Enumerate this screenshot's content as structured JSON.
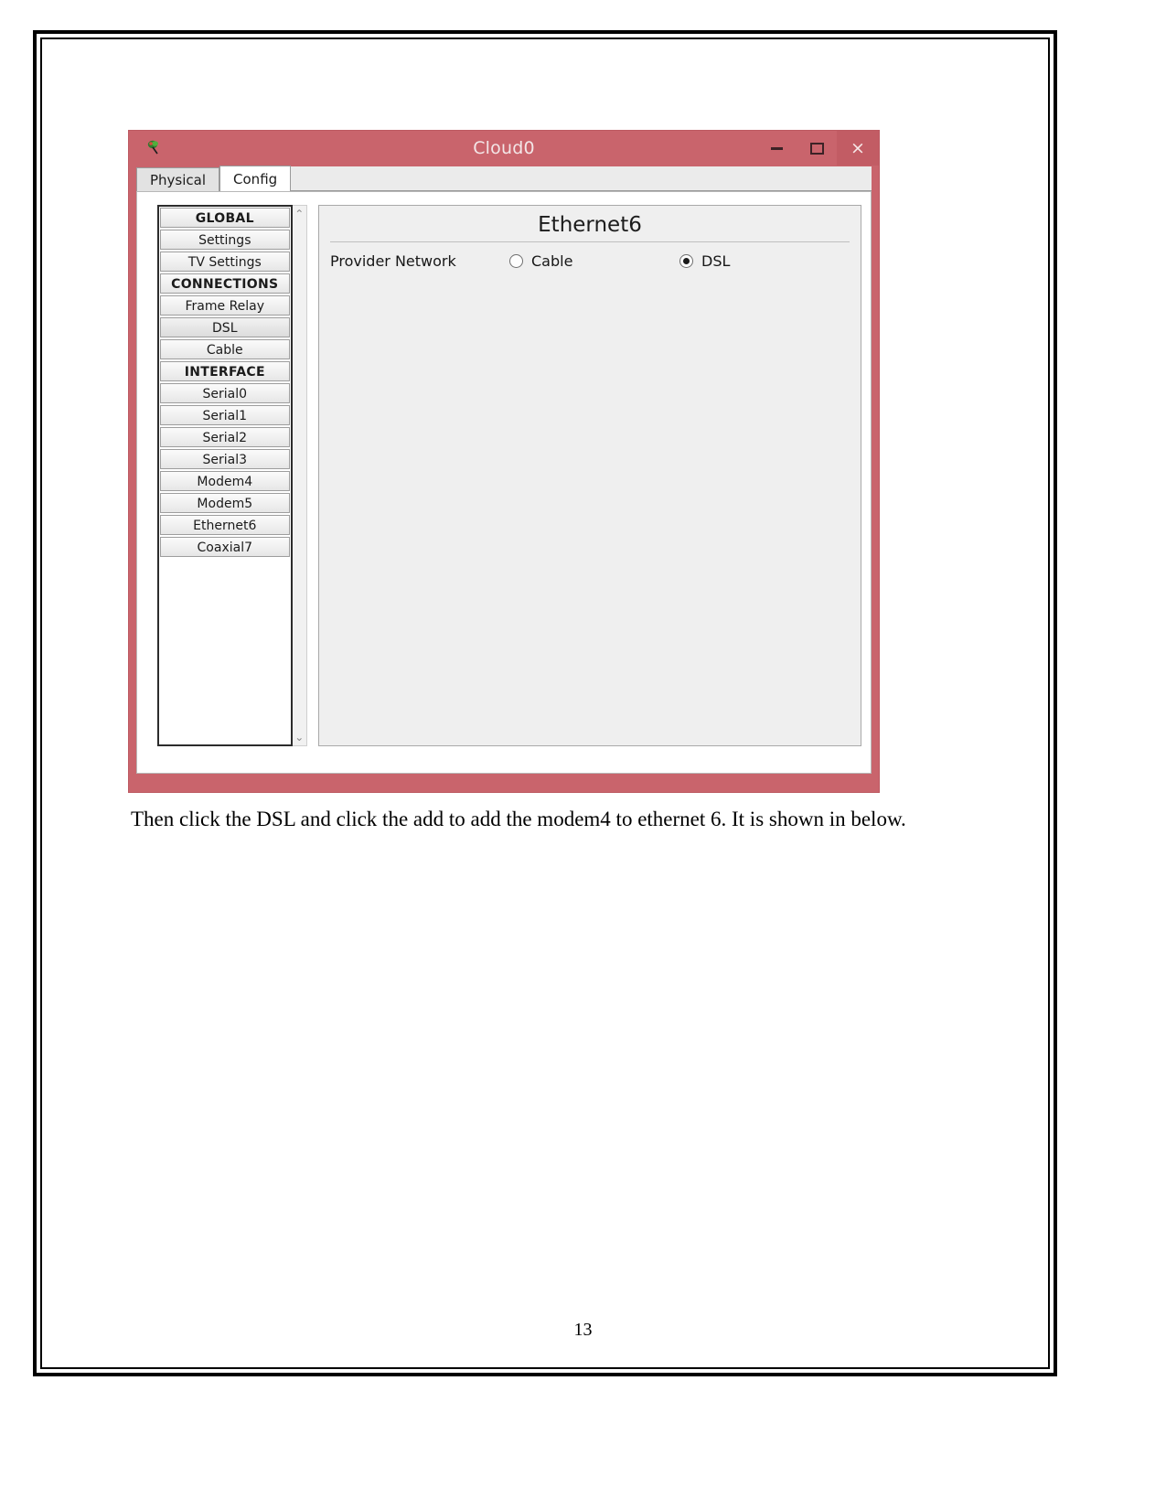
{
  "document": {
    "caption": "Then click the DSL and click the add to add the modem4 to ethernet 6. It is shown in below.",
    "page_number": "13"
  },
  "window": {
    "title": "Cloud0",
    "icon": "packet-tracer-cloud-icon",
    "controls": {
      "minimize": "–",
      "maximize": "□",
      "close": "×"
    },
    "accent_color": "#c9646c",
    "tabs": [
      {
        "label": "Physical",
        "active": false
      },
      {
        "label": "Config",
        "active": true
      }
    ]
  },
  "sidebar": {
    "items": [
      {
        "label": "GLOBAL",
        "type": "group",
        "selected": false
      },
      {
        "label": "Settings",
        "type": "item",
        "selected": false
      },
      {
        "label": "TV Settings",
        "type": "item",
        "selected": false
      },
      {
        "label": "CONNECTIONS",
        "type": "group",
        "selected": false
      },
      {
        "label": "Frame Relay",
        "type": "item",
        "selected": false
      },
      {
        "label": "DSL",
        "type": "item",
        "selected": true
      },
      {
        "label": "Cable",
        "type": "item",
        "selected": false
      },
      {
        "label": "INTERFACE",
        "type": "group",
        "selected": false
      },
      {
        "label": "Serial0",
        "type": "item",
        "selected": false
      },
      {
        "label": "Serial1",
        "type": "item",
        "selected": false
      },
      {
        "label": "Serial2",
        "type": "item",
        "selected": false
      },
      {
        "label": "Serial3",
        "type": "item",
        "selected": false
      },
      {
        "label": "Modem4",
        "type": "item",
        "selected": false
      },
      {
        "label": "Modem5",
        "type": "item",
        "selected": false
      },
      {
        "label": "Ethernet6",
        "type": "item",
        "selected": false
      },
      {
        "label": "Coaxial7",
        "type": "item",
        "selected": false
      }
    ],
    "scrollbar": {
      "up_arrow": "⌃",
      "down_arrow": "⌄"
    }
  },
  "config_panel": {
    "heading": "Ethernet6",
    "provider_network": {
      "label": "Provider Network",
      "options": [
        {
          "label": "Cable",
          "checked": false
        },
        {
          "label": "DSL",
          "checked": true
        }
      ]
    }
  }
}
